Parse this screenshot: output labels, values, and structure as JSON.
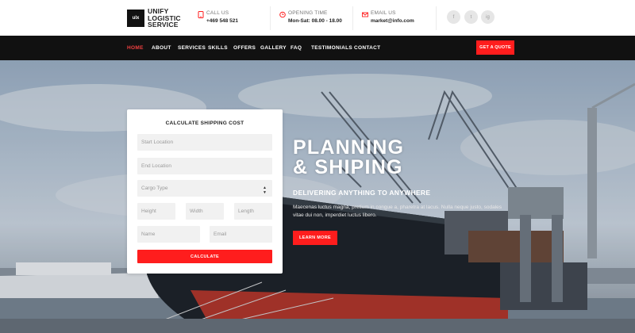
{
  "brand": {
    "mark": "ulx",
    "lines": [
      "UNIFY",
      "LOGISTIC",
      "SERVICE"
    ]
  },
  "contact": {
    "call": {
      "label": "CALL US",
      "value": "+469 548 521"
    },
    "hours": {
      "label": "OPENING TIME",
      "value": "Mon-Sat: 08.00 - 18.00"
    },
    "email": {
      "label": "EMAIL US",
      "value": "market@info.com"
    }
  },
  "social": [
    "f",
    "t",
    "ig"
  ],
  "nav": [
    "HOME",
    "ABOUT",
    "SERVICES",
    "SKILLS",
    "OFFERS",
    "GALLERY",
    "FAQ",
    "TESTIMONIALS",
    "CONTACT"
  ],
  "nav_active": "HOME",
  "quote_button": "GET A QUOTE",
  "form": {
    "title": "CALCULATE SHIPPING COST",
    "start_location": "Start Location",
    "end_location": "End Location",
    "cargo_type": "Cargo Type",
    "height": "Height",
    "width": "Width",
    "length": "Length",
    "name": "Name",
    "email": "Email",
    "calculate": "CALCULATE"
  },
  "hero": {
    "title_line1": "PLANNING",
    "title_line2": "& SHIPING",
    "subtitle": "DELIVERING ANYTHING TO ANYWHERE",
    "description": "Maecenas luctus magna, pretium in congue a, pharetra at lacus. Nulla neque justo, sodales vitae dui non, imperdiet luctus libero.",
    "button": "LEARN MORE"
  },
  "colors": {
    "accent": "#ff1d1d",
    "nav_bg": "#111111"
  },
  "icons": {
    "call": "phone-icon",
    "hours": "clock-icon",
    "email": "envelope-icon"
  }
}
